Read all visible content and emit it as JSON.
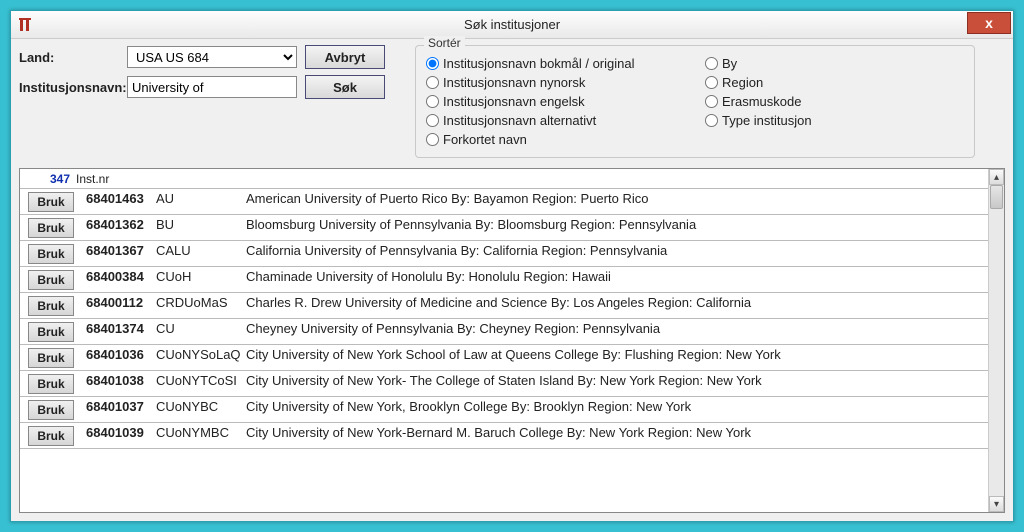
{
  "window": {
    "title": "Søk institusjoner",
    "close": "x"
  },
  "form": {
    "country_label": "Land:",
    "country_value": "USA US 684",
    "name_label": "Institusjonsnavn:",
    "name_value": "University of",
    "cancel_label": "Avbryt",
    "search_label": "Søk"
  },
  "sort": {
    "legend": "Sortér",
    "options_left": [
      "Institusjonsnavn bokmål / original",
      "Institusjonsnavn nynorsk",
      "Institusjonsnavn engelsk",
      "Institusjonsnavn alternativt",
      "Forkortet navn"
    ],
    "options_right": [
      "By",
      "Region",
      "Erasmuskode",
      "Type institusjon"
    ],
    "selected": "Institusjonsnavn bokmål / original"
  },
  "results": {
    "count": "347",
    "instnr_label": "Inst.nr",
    "use_label": "Bruk",
    "rows": [
      {
        "id": "68401463",
        "code": "AU",
        "desc": "American University of Puerto Rico By: Bayamon Region: Puerto Rico"
      },
      {
        "id": "68401362",
        "code": "BU",
        "desc": "Bloomsburg University of Pennsylvania By: Bloomsburg Region: Pennsylvania"
      },
      {
        "id": "68401367",
        "code": "CALU",
        "desc": "California University of Pennsylvania By: California Region: Pennsylvania"
      },
      {
        "id": "68400384",
        "code": "CUoH",
        "desc": "Chaminade University of Honolulu By: Honolulu Region: Hawaii"
      },
      {
        "id": "68400112",
        "code": "CRDUoMaS",
        "desc": "Charles R. Drew University of Medicine and Science By: Los Angeles Region: California"
      },
      {
        "id": "68401374",
        "code": "CU",
        "desc": "Cheyney University of Pennsylvania By: Cheyney Region: Pennsylvania"
      },
      {
        "id": "68401036",
        "code": "CUoNYSoLaQ",
        "desc": "City University of New York School of Law at Queens College By: Flushing Region: New York"
      },
      {
        "id": "68401038",
        "code": "CUoNYTCoSI",
        "desc": "City University of New York- The College of Staten Island By: New York Region: New York"
      },
      {
        "id": "68401037",
        "code": "CUoNYBC",
        "desc": "City University of New York, Brooklyn College By: Brooklyn Region: New York"
      },
      {
        "id": "68401039",
        "code": "CUoNYMBC",
        "desc": "City University of New York-Bernard M. Baruch College By: New York Region: New York"
      }
    ]
  }
}
